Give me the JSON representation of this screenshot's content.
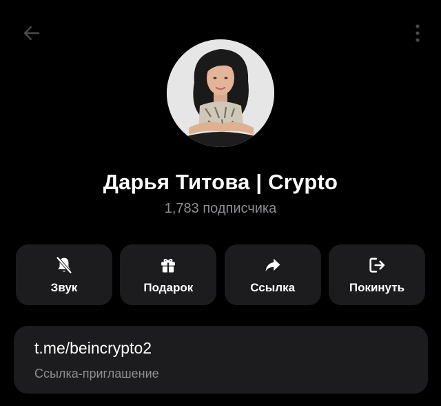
{
  "header": {
    "back_icon": "arrow-left-icon",
    "menu_icon": "more-vertical-icon"
  },
  "profile": {
    "name": "Дарья Титова | Crypto",
    "subscribers": "1,783 подписчика"
  },
  "actions": [
    {
      "label": "Звук",
      "icon": "bell-off-icon"
    },
    {
      "label": "Подарок",
      "icon": "gift-icon"
    },
    {
      "label": "Ссылка",
      "icon": "share-arrow-icon"
    },
    {
      "label": "Покинуть",
      "icon": "leave-icon"
    }
  ],
  "invite": {
    "url": "t.me/beincrypto2",
    "caption": "Ссылка-приглашение"
  },
  "colors": {
    "background": "#000000",
    "card": "#1c1c1e",
    "secondary_text": "#8e8e93",
    "icon_dim": "#555555"
  }
}
